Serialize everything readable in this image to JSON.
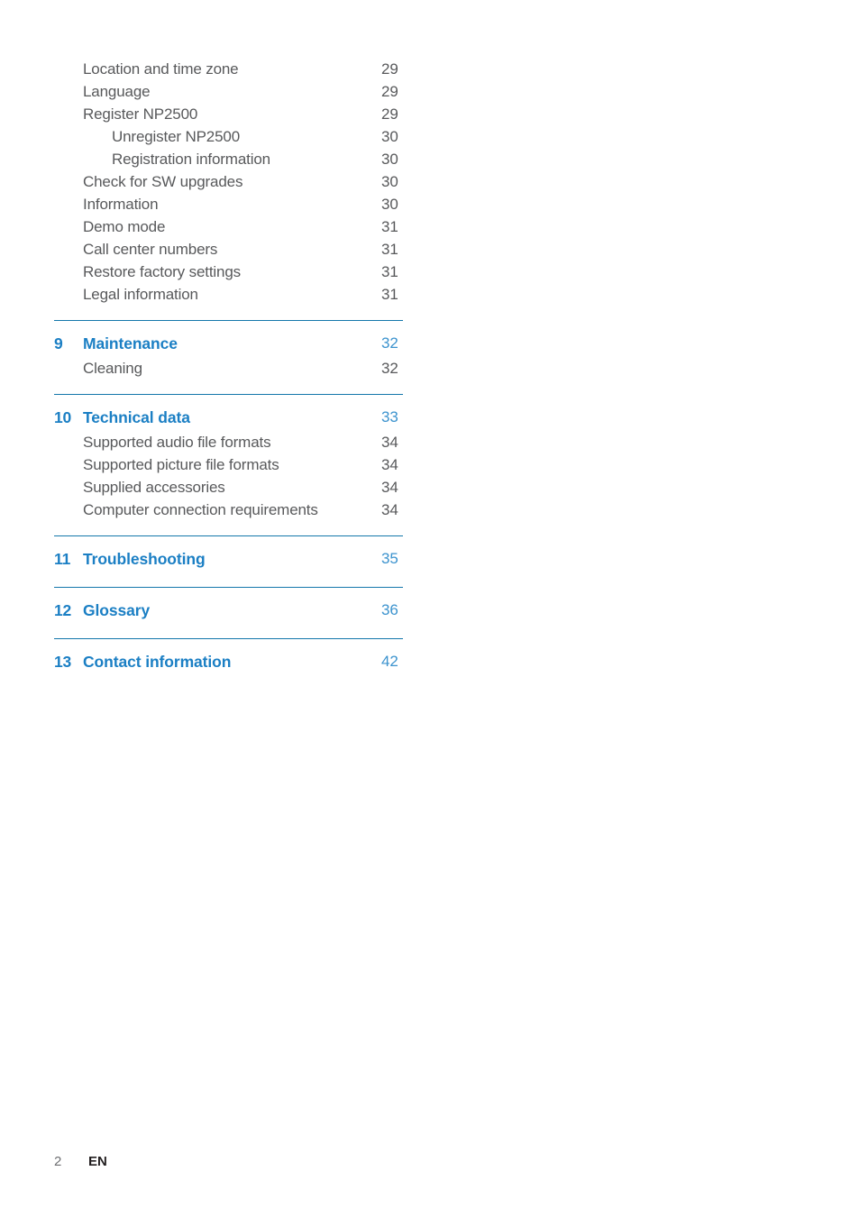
{
  "document": {
    "type": "table-of-contents",
    "footer": {
      "page_number": "2",
      "language_code": "EN"
    },
    "colors": {
      "heading_blue": "#1b7fc4",
      "rule_blue": "#1477ab",
      "body_gray": "#58595b",
      "section_page_blue": "#3c93ce",
      "footer_gray": "#6d6e71",
      "footer_lang": "#231f20"
    }
  },
  "toc": {
    "groups": [
      {
        "id": "continued-entries",
        "rule_above": false,
        "heading": null,
        "entries": [
          {
            "level": 1,
            "label": "Location and time zone",
            "page": "29"
          },
          {
            "level": 1,
            "label": "Language",
            "page": "29"
          },
          {
            "level": 1,
            "label": "Register NP2500",
            "page": "29"
          },
          {
            "level": 2,
            "label": "Unregister NP2500",
            "page": "30"
          },
          {
            "level": 2,
            "label": "Registration information",
            "page": "30"
          },
          {
            "level": 1,
            "label": "Check for SW upgrades",
            "page": "30"
          },
          {
            "level": 1,
            "label": "Information",
            "page": "30"
          },
          {
            "level": 1,
            "label": "Demo mode",
            "page": "31"
          },
          {
            "level": 1,
            "label": "Call center numbers",
            "page": "31"
          },
          {
            "level": 1,
            "label": "Restore factory settings",
            "page": "31"
          },
          {
            "level": 1,
            "label": "Legal information",
            "page": "31"
          }
        ]
      },
      {
        "id": "maintenance",
        "rule_above": true,
        "heading": {
          "number": "9",
          "title": "Maintenance",
          "page": "32"
        },
        "entries": [
          {
            "level": 1,
            "label": "Cleaning",
            "page": "32"
          }
        ]
      },
      {
        "id": "technical-data",
        "rule_above": true,
        "heading": {
          "number": "10",
          "title": "Technical data",
          "page": "33"
        },
        "entries": [
          {
            "level": 1,
            "label": "Supported audio file formats",
            "page": "34"
          },
          {
            "level": 1,
            "label": "Supported picture file formats",
            "page": "34"
          },
          {
            "level": 1,
            "label": "Supplied accessories",
            "page": "34"
          },
          {
            "level": 1,
            "label": "Computer connection requirements",
            "page": "34"
          }
        ]
      },
      {
        "id": "troubleshooting",
        "rule_above": true,
        "heading": {
          "number": "11",
          "title": "Troubleshooting",
          "page": "35"
        },
        "entries": []
      },
      {
        "id": "glossary",
        "rule_above": true,
        "heading": {
          "number": "12",
          "title": "Glossary",
          "page": "36"
        },
        "entries": []
      },
      {
        "id": "contact-information",
        "rule_above": true,
        "heading": {
          "number": "13",
          "title": "Contact information",
          "page": "42"
        },
        "entries": []
      }
    ]
  }
}
